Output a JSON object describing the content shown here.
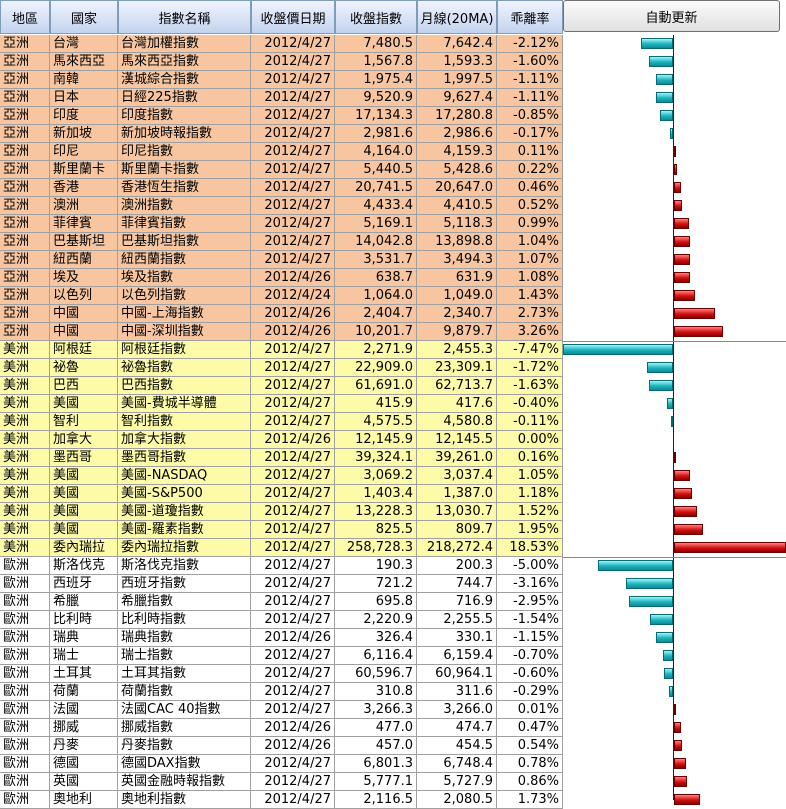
{
  "header": {
    "region": "地區",
    "country": "國家",
    "index_name": "指數名稱",
    "close_date": "收盤價日期",
    "close_index": "收盤指數",
    "ma20": "月線(20MA)",
    "deviation": "乖離率"
  },
  "auto_update_button": "自動更新",
  "colors": {
    "asia": "#f7c6a0",
    "americas": "#fdfba8",
    "europe": "#ffffff",
    "negative_bar": "#1cb4bf",
    "positive_bar": "#d21010"
  },
  "rows": [
    {
      "region": "亞洲",
      "country": "台灣",
      "name": "台灣加權指數",
      "date": "2012/4/27",
      "close": "7,480.5",
      "ma": "7,642.4",
      "dev": "-2.12%",
      "v": -2.12,
      "g": "asia"
    },
    {
      "region": "亞洲",
      "country": "馬來西亞",
      "name": "馬來西亞指數",
      "date": "2012/4/27",
      "close": "1,567.8",
      "ma": "1,593.3",
      "dev": "-1.60%",
      "v": -1.6,
      "g": "asia"
    },
    {
      "region": "亞洲",
      "country": "南韓",
      "name": "漢城綜合指數",
      "date": "2012/4/27",
      "close": "1,975.4",
      "ma": "1,997.5",
      "dev": "-1.11%",
      "v": -1.11,
      "g": "asia"
    },
    {
      "region": "亞洲",
      "country": "日本",
      "name": "日經225指數",
      "date": "2012/4/27",
      "close": "9,520.9",
      "ma": "9,627.4",
      "dev": "-1.11%",
      "v": -1.11,
      "g": "asia"
    },
    {
      "region": "亞洲",
      "country": "印度",
      "name": "印度指數",
      "date": "2012/4/27",
      "close": "17,134.3",
      "ma": "17,280.8",
      "dev": "-0.85%",
      "v": -0.85,
      "g": "asia"
    },
    {
      "region": "亞洲",
      "country": "新加坡",
      "name": "新加坡時報指數",
      "date": "2012/4/27",
      "close": "2,981.6",
      "ma": "2,986.6",
      "dev": "-0.17%",
      "v": -0.17,
      "g": "asia"
    },
    {
      "region": "亞洲",
      "country": "印尼",
      "name": "印尼指數",
      "date": "2012/4/27",
      "close": "4,164.0",
      "ma": "4,159.3",
      "dev": "0.11%",
      "v": 0.11,
      "g": "asia"
    },
    {
      "region": "亞洲",
      "country": "斯里蘭卡",
      "name": "斯里蘭卡指數",
      "date": "2012/4/27",
      "close": "5,440.5",
      "ma": "5,428.6",
      "dev": "0.22%",
      "v": 0.22,
      "g": "asia"
    },
    {
      "region": "亞洲",
      "country": "香港",
      "name": "香港恆生指數",
      "date": "2012/4/27",
      "close": "20,741.5",
      "ma": "20,647.0",
      "dev": "0.46%",
      "v": 0.46,
      "g": "asia"
    },
    {
      "region": "亞洲",
      "country": "澳洲",
      "name": "澳洲指數",
      "date": "2012/4/27",
      "close": "4,433.4",
      "ma": "4,410.5",
      "dev": "0.52%",
      "v": 0.52,
      "g": "asia"
    },
    {
      "region": "亞洲",
      "country": "菲律賓",
      "name": "菲律賓指數",
      "date": "2012/4/27",
      "close": "5,169.1",
      "ma": "5,118.3",
      "dev": "0.99%",
      "v": 0.99,
      "g": "asia"
    },
    {
      "region": "亞洲",
      "country": "巴基斯坦",
      "name": "巴基斯坦指數",
      "date": "2012/4/27",
      "close": "14,042.8",
      "ma": "13,898.8",
      "dev": "1.04%",
      "v": 1.04,
      "g": "asia"
    },
    {
      "region": "亞洲",
      "country": "紐西蘭",
      "name": "紐西蘭指數",
      "date": "2012/4/27",
      "close": "3,531.7",
      "ma": "3,494.3",
      "dev": "1.07%",
      "v": 1.07,
      "g": "asia"
    },
    {
      "region": "亞洲",
      "country": "埃及",
      "name": "埃及指數",
      "date": "2012/4/26",
      "close": "638.7",
      "ma": "631.9",
      "dev": "1.08%",
      "v": 1.08,
      "g": "asia"
    },
    {
      "region": "亞洲",
      "country": "以色列",
      "name": "以色列指數",
      "date": "2012/4/24",
      "close": "1,064.0",
      "ma": "1,049.0",
      "dev": "1.43%",
      "v": 1.43,
      "g": "asia"
    },
    {
      "region": "亞洲",
      "country": "中國",
      "name": "中國-上海指數",
      "date": "2012/4/26",
      "close": "2,404.7",
      "ma": "2,340.7",
      "dev": "2.73%",
      "v": 2.73,
      "g": "asia"
    },
    {
      "region": "亞洲",
      "country": "中國",
      "name": "中國-深圳指數",
      "date": "2012/4/26",
      "close": "10,201.7",
      "ma": "9,879.7",
      "dev": "3.26%",
      "v": 3.26,
      "g": "asia"
    },
    {
      "region": "美洲",
      "country": "阿根廷",
      "name": "阿根廷指數",
      "date": "2012/4/27",
      "close": "2,271.9",
      "ma": "2,455.3",
      "dev": "-7.47%",
      "v": -7.47,
      "g": "amer"
    },
    {
      "region": "美洲",
      "country": "祕魯",
      "name": "祕魯指數",
      "date": "2012/4/27",
      "close": "22,909.0",
      "ma": "23,309.1",
      "dev": "-1.72%",
      "v": -1.72,
      "g": "amer"
    },
    {
      "region": "美洲",
      "country": "巴西",
      "name": "巴西指數",
      "date": "2012/4/27",
      "close": "61,691.0",
      "ma": "62,713.7",
      "dev": "-1.63%",
      "v": -1.63,
      "g": "amer"
    },
    {
      "region": "美洲",
      "country": "美國",
      "name": "美國-費城半導體",
      "date": "2012/4/27",
      "close": "415.9",
      "ma": "417.6",
      "dev": "-0.40%",
      "v": -0.4,
      "g": "amer"
    },
    {
      "region": "美洲",
      "country": "智利",
      "name": "智利指數",
      "date": "2012/4/27",
      "close": "4,575.5",
      "ma": "4,580.8",
      "dev": "-0.11%",
      "v": -0.11,
      "g": "amer"
    },
    {
      "region": "美洲",
      "country": "加拿大",
      "name": "加拿大指數",
      "date": "2012/4/26",
      "close": "12,145.9",
      "ma": "12,145.5",
      "dev": "0.00%",
      "v": 0.0,
      "g": "amer"
    },
    {
      "region": "美洲",
      "country": "墨西哥",
      "name": "墨西哥指數",
      "date": "2012/4/27",
      "close": "39,324.1",
      "ma": "39,261.0",
      "dev": "0.16%",
      "v": 0.16,
      "g": "amer"
    },
    {
      "region": "美洲",
      "country": "美國",
      "name": "美國-NASDAQ",
      "date": "2012/4/27",
      "close": "3,069.2",
      "ma": "3,037.4",
      "dev": "1.05%",
      "v": 1.05,
      "g": "amer"
    },
    {
      "region": "美洲",
      "country": "美國",
      "name": "美國-S&P500",
      "date": "2012/4/27",
      "close": "1,403.4",
      "ma": "1,387.0",
      "dev": "1.18%",
      "v": 1.18,
      "g": "amer"
    },
    {
      "region": "美洲",
      "country": "美國",
      "name": "美國-道瓊指數",
      "date": "2012/4/27",
      "close": "13,228.3",
      "ma": "13,030.7",
      "dev": "1.52%",
      "v": 1.52,
      "g": "amer"
    },
    {
      "region": "美洲",
      "country": "美國",
      "name": "美國-羅素指數",
      "date": "2012/4/27",
      "close": "825.5",
      "ma": "809.7",
      "dev": "1.95%",
      "v": 1.95,
      "g": "amer"
    },
    {
      "region": "美洲",
      "country": "委內瑞拉",
      "name": "委內瑞拉指數",
      "date": "2012/4/27",
      "close": "258,728.3",
      "ma": "218,272.4",
      "dev": "18.53%",
      "v": 18.53,
      "g": "amer"
    },
    {
      "region": "歐洲",
      "country": "斯洛伐克",
      "name": "斯洛伐克指數",
      "date": "2012/4/27",
      "close": "190.3",
      "ma": "200.3",
      "dev": "-5.00%",
      "v": -5.0,
      "g": "euro"
    },
    {
      "region": "歐洲",
      "country": "西班牙",
      "name": "西班牙指數",
      "date": "2012/4/27",
      "close": "721.2",
      "ma": "744.7",
      "dev": "-3.16%",
      "v": -3.16,
      "g": "euro"
    },
    {
      "region": "歐洲",
      "country": "希臘",
      "name": "希臘指數",
      "date": "2012/4/27",
      "close": "695.8",
      "ma": "716.9",
      "dev": "-2.95%",
      "v": -2.95,
      "g": "euro"
    },
    {
      "region": "歐洲",
      "country": "比利時",
      "name": "比利時指數",
      "date": "2012/4/27",
      "close": "2,220.9",
      "ma": "2,255.5",
      "dev": "-1.54%",
      "v": -1.54,
      "g": "euro"
    },
    {
      "region": "歐洲",
      "country": "瑞典",
      "name": "瑞典指數",
      "date": "2012/4/26",
      "close": "326.4",
      "ma": "330.1",
      "dev": "-1.15%",
      "v": -1.15,
      "g": "euro"
    },
    {
      "region": "歐洲",
      "country": "瑞士",
      "name": "瑞士指數",
      "date": "2012/4/27",
      "close": "6,116.4",
      "ma": "6,159.4",
      "dev": "-0.70%",
      "v": -0.7,
      "g": "euro"
    },
    {
      "region": "歐洲",
      "country": "土耳其",
      "name": "土耳其指數",
      "date": "2012/4/27",
      "close": "60,596.7",
      "ma": "60,964.1",
      "dev": "-0.60%",
      "v": -0.6,
      "g": "euro"
    },
    {
      "region": "歐洲",
      "country": "荷蘭",
      "name": "荷蘭指數",
      "date": "2012/4/27",
      "close": "310.8",
      "ma": "311.6",
      "dev": "-0.29%",
      "v": -0.29,
      "g": "euro"
    },
    {
      "region": "歐洲",
      "country": "法國",
      "name": "法國CAC 40指數",
      "date": "2012/4/27",
      "close": "3,266.3",
      "ma": "3,266.0",
      "dev": "0.01%",
      "v": 0.01,
      "g": "euro"
    },
    {
      "region": "歐洲",
      "country": "挪威",
      "name": "挪威指數",
      "date": "2012/4/26",
      "close": "477.0",
      "ma": "474.7",
      "dev": "0.47%",
      "v": 0.47,
      "g": "euro"
    },
    {
      "region": "歐洲",
      "country": "丹麥",
      "name": "丹麥指數",
      "date": "2012/4/26",
      "close": "457.0",
      "ma": "454.5",
      "dev": "0.54%",
      "v": 0.54,
      "g": "euro"
    },
    {
      "region": "歐洲",
      "country": "德國",
      "name": "德國DAX指數",
      "date": "2012/4/27",
      "close": "6,801.3",
      "ma": "6,748.4",
      "dev": "0.78%",
      "v": 0.78,
      "g": "euro"
    },
    {
      "region": "歐洲",
      "country": "英國",
      "name": "英國金融時報指數",
      "date": "2012/4/27",
      "close": "5,777.1",
      "ma": "5,727.9",
      "dev": "0.86%",
      "v": 0.86,
      "g": "euro"
    },
    {
      "region": "歐洲",
      "country": "奧地利",
      "name": "奧地利指數",
      "date": "2012/4/27",
      "close": "2,116.5",
      "ma": "2,080.5",
      "dev": "1.73%",
      "v": 1.73,
      "g": "euro"
    }
  ]
}
